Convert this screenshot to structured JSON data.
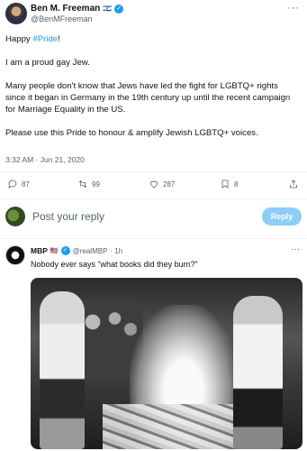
{
  "tweet": {
    "author_name": "Ben M. Freeman",
    "author_flag": "🇮🇱",
    "author_handle": "@BenMFreeman",
    "text_intro": "Happy ",
    "hashtag": "#Pride",
    "text_intro_end": "!",
    "paragraph_2": "I am a proud gay Jew.",
    "paragraph_3": "Many people don't know that Jews have led the fight for LGBTQ+ rights since it began in Germany in the 19th century up until the recent campaign for Marriage Equality in the US.",
    "paragraph_4": "Please use this Pride to honour & amplify Jewish LGBTQ+ voices.",
    "timestamp": "3:32 AM · Jun 21, 2020",
    "more_icon": "more-horizontal-icon"
  },
  "actions": {
    "replies": "87",
    "retweets": "99",
    "likes": "287",
    "bookmarks": "8"
  },
  "reply_bar": {
    "placeholder": "Post your reply",
    "button_label": "Reply"
  },
  "reply": {
    "author_name": "MBP",
    "author_flag": "🇺🇸",
    "author_handle": "@realMBP",
    "time": "· 1h",
    "text": "Nobody ever says “what books did they burn?”"
  },
  "colors": {
    "accent": "#1d9bf0",
    "secondary_text": "#536471",
    "reply_button_bg": "#8ecdf8"
  }
}
